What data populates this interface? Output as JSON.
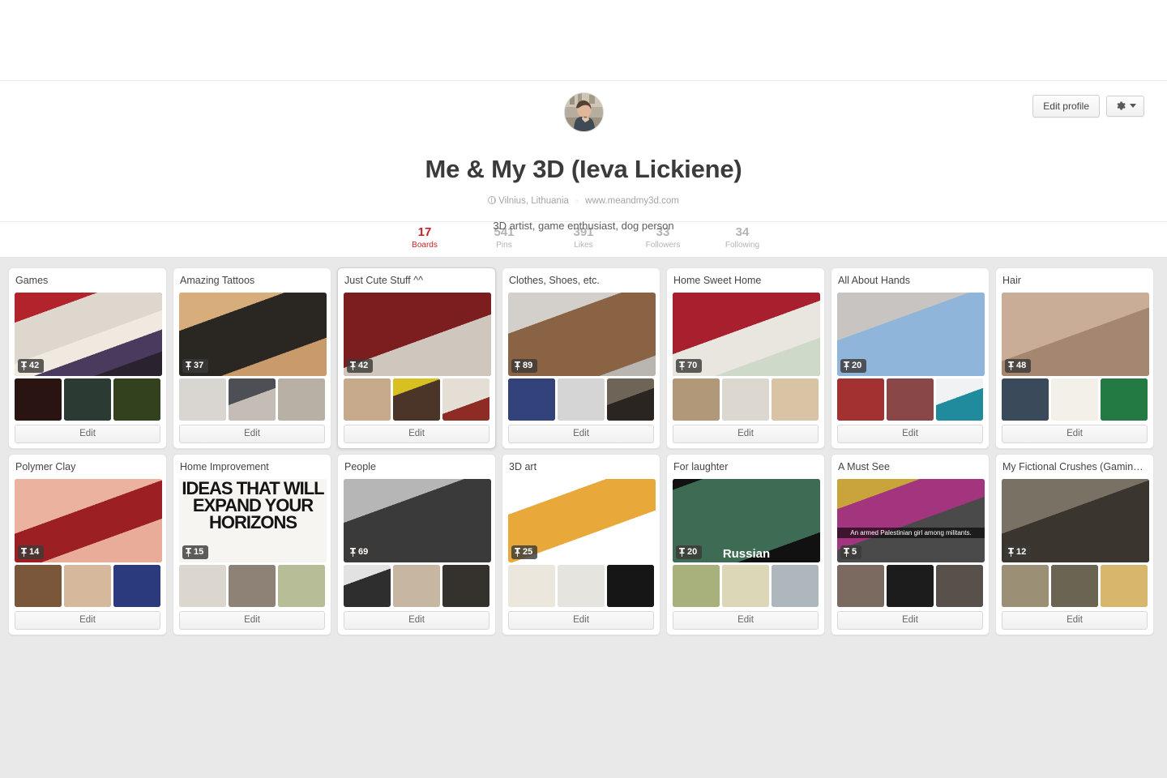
{
  "header": {
    "edit_profile_label": "Edit profile",
    "gear_icon": "gear-icon",
    "caret_icon": "chevron-down-icon",
    "avatar_alt": "profile-avatar",
    "name": "Me & My 3D (Ieva Lickiene)",
    "location_icon": "globe-icon",
    "location": "Vilnius, Lithuania",
    "separator": "·",
    "website": "www.meandmy3d.com",
    "about": "3D artist, game enthusiast, dog person"
  },
  "stats": [
    {
      "num": "17",
      "label": "Boards",
      "active": true
    },
    {
      "num": "541",
      "label": "Pins",
      "active": false
    },
    {
      "num": "391",
      "label": "Likes",
      "active": false
    },
    {
      "num": "33",
      "label": "Followers",
      "active": false
    },
    {
      "num": "34",
      "label": "Following",
      "active": false
    }
  ],
  "edit_label": "Edit",
  "pin_icon": "pushpin-icon",
  "boards": [
    {
      "title": "Games",
      "pins": "42",
      "hovered": false,
      "cover": "cosplay-mass-effect-costumes",
      "cover_caption": "",
      "thumbs": [
        "pc-build-fps-card-red",
        "pc-build-skyrim-card",
        "pc-build-civilization-card"
      ]
    },
    {
      "title": "Amazing Tattoos",
      "pins": "37",
      "hovered": false,
      "cover": "black-dragon-arm-tattoo",
      "cover_caption": "",
      "thumbs": [
        "portrait-tattoo-leg",
        "sleeve-tattoo-arm",
        "crowd-scene-tattoo"
      ]
    },
    {
      "title": "Just Cute Stuff ^^",
      "pins": "42",
      "hovered": true,
      "cover": "blanket-snail-on-bed",
      "cover_caption": "",
      "thumbs": [
        "dachshund-puppies-basket",
        "gift-box-ring",
        "flowers-with-note"
      ]
    },
    {
      "title": "Clothes, Shoes, etc.",
      "pins": "89",
      "hovered": false,
      "cover": "brown-strappy-suede-boots",
      "cover_caption": "",
      "thumbs": [
        "blue-patterned-sandals",
        "grey-pig-tshirt",
        "black-t-strap-heels"
      ]
    },
    {
      "title": "Home Sweet Home",
      "pins": "70",
      "hovered": false,
      "cover": "red-wall-modern-bathroom",
      "cover_caption": "",
      "thumbs": [
        "stone-shower-bathroom",
        "white-modern-bathroom",
        "beige-tiled-bathroom"
      ]
    },
    {
      "title": "All About Hands",
      "pins": "20",
      "hovered": false,
      "cover": "blue-penguin-nail-art",
      "cover_caption": "",
      "thumbs": [
        "red-christmas-nails",
        "white-bow-nails",
        "teal-glitter-nails"
      ]
    },
    {
      "title": "Hair",
      "pins": "48",
      "hovered": false,
      "cover": "braid-tutorial-four-panel",
      "cover_caption": "",
      "thumbs": [
        "updo-short-hair",
        "black-bob-haircut",
        "green-dress-pixie-cut"
      ]
    },
    {
      "title": "Polymer Clay",
      "pins": "14",
      "hovered": false,
      "cover": "red-clay-figure-in-fingers",
      "cover_caption": "",
      "thumbs": [
        "green-frog-ring",
        "clay-rings-on-hand",
        "clay-pendant-necklace"
      ]
    },
    {
      "title": "Home Improvement",
      "pins": "15",
      "hovered": false,
      "cover": "ideas-that-will-expand-your-horizons-poster",
      "cover_caption": "IDEAS THAT WILL EXPAND YOUR HORIZONS",
      "thumbs": [
        "wooden-shelf-corner",
        "stone-countertop-cabinet",
        "wooden-ladder-outdoor"
      ]
    },
    {
      "title": "People",
      "pins": "69",
      "hovered": false,
      "cover": "bearded-man-leather-vest-bw",
      "cover_caption": "",
      "thumbs": [
        "suited-men-group-bw",
        "man-in-coat-portrait",
        "man-black-tshirt-portrait"
      ]
    },
    {
      "title": "3D art",
      "pins": "25",
      "hovered": false,
      "cover": "isometric-3d-room-render",
      "cover_caption": "",
      "thumbs": [
        "3d-desk-render-light",
        "3d-desk-render-grey",
        "blender-tutorial-card"
      ]
    },
    {
      "title": "For laughter",
      "pins": "20",
      "hovered": false,
      "cover": "russian-man-on-swing-meme",
      "cover_caption": "Russian",
      "thumbs": [
        "kids-costumes-street",
        "framed-sign-on-wall",
        "men-working-collage"
      ]
    },
    {
      "title": "A Must See",
      "pins": "5",
      "hovered": false,
      "cover": "palestinian-girl-among-militants",
      "cover_caption": "An armed Palestinian girl among militants.",
      "thumbs": [
        "blonde-braided-woman",
        "choir-group-caption-meme",
        "movie-scene-two-people"
      ]
    },
    {
      "title": "My Fictional Crushes (Gamin…",
      "pins": "12",
      "hovered": false,
      "cover": "blond-stubbled-man-fantasy",
      "cover_caption": "",
      "thumbs": [
        "silhouette-warrior-dusk",
        "armored-fantasy-knight",
        "blond-man-yellow-shirt"
      ]
    }
  ]
}
